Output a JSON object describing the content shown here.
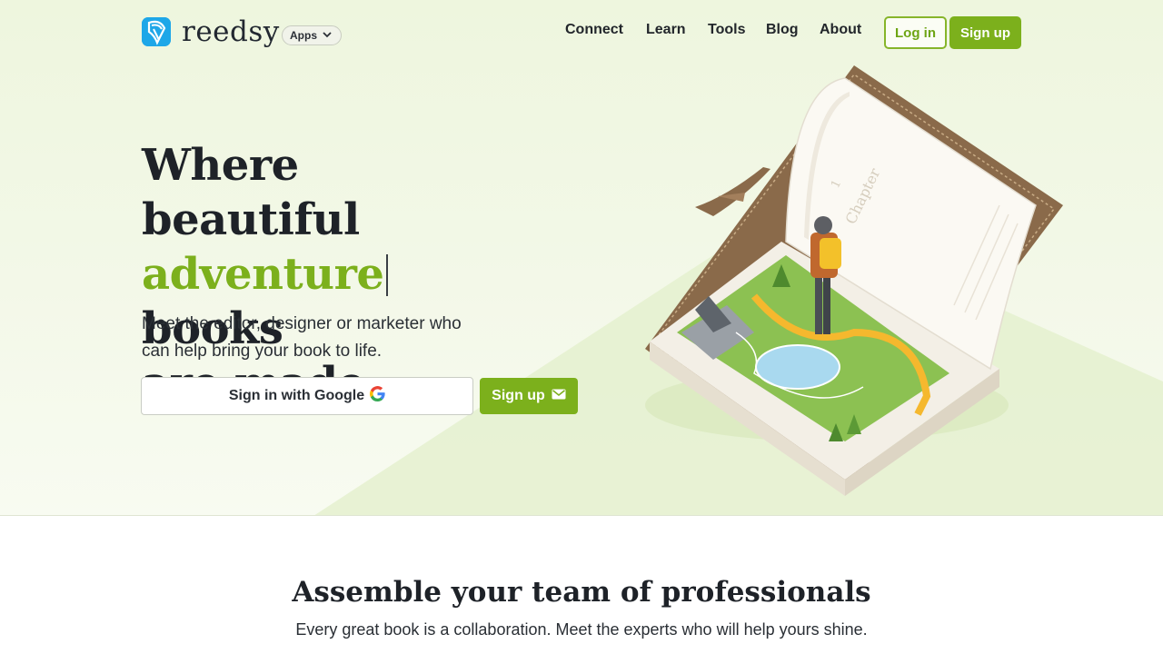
{
  "header": {
    "brand": "reedsy",
    "apps_label": "Apps",
    "nav": [
      {
        "label": "Connect"
      },
      {
        "label": "Learn"
      },
      {
        "label": "Tools"
      },
      {
        "label": "Blog"
      },
      {
        "label": "About"
      }
    ],
    "login_label": "Log in",
    "signup_label": "Sign up"
  },
  "hero": {
    "headline_line1": "Where beautiful",
    "headline_accent": "adventure",
    "headline_line2_rest": "books",
    "headline_line3": "are made",
    "subhead": "Meet the editor, designer or marketer who can help bring your book to life.",
    "google_button_label": "Sign in with Google",
    "signup_button_label": "Sign up",
    "illustration": {
      "chapter_number": "1",
      "chapter_label": "Chapter"
    }
  },
  "team_section": {
    "title": "Assemble your team of professionals",
    "subtitle": "Every great book is a collaboration. Meet the experts who will help yours shine."
  },
  "colors": {
    "brand_green": "#7cb01c",
    "brand_blue": "#1ea7e8",
    "hero_background": "#eef6de",
    "text_dark": "#1e2228"
  }
}
